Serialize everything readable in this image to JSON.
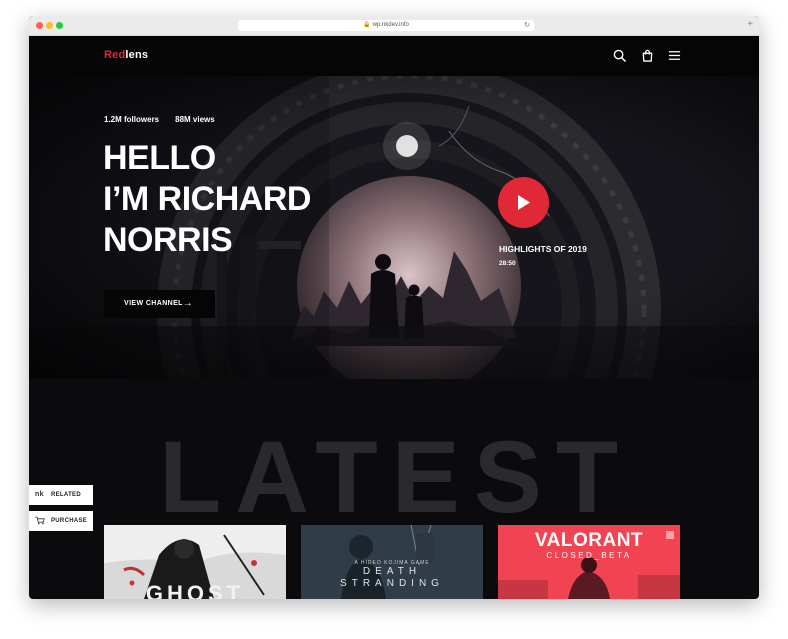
{
  "browser": {
    "url": "wp.nkdev.info"
  },
  "nav": {
    "logo_accent": "Red",
    "logo_rest": "lens",
    "icons": [
      "search-icon",
      "cart-icon",
      "menu-icon"
    ]
  },
  "hero": {
    "followers": "1.2M followers",
    "views": "88M views",
    "headline": [
      "HELLO",
      "I’M RICHARD",
      "NORRIS"
    ],
    "cta_label": "VIEW CHANNEL",
    "cta_icon": "→",
    "highlight_title": "HIGHLIGHTS OF 2019",
    "highlight_duration": "28:50"
  },
  "latest": {
    "watermark": "LATEST"
  },
  "side_buttons": [
    {
      "label": "RELATED",
      "icon": "nk-logo-icon"
    },
    {
      "label": "PURCHASE",
      "icon": "cart-icon"
    }
  ],
  "cards": [
    {
      "title": "GHOST"
    },
    {
      "subtitle": "A HIDEO KOJIMA GAME",
      "title": "DEATH",
      "title2": "STRANDING"
    },
    {
      "title": "VALORANT",
      "subtitle": "CLOSED_BETA"
    }
  ],
  "colors": {
    "accent": "#e02836",
    "background": "#0b0b0d",
    "valorant": "#ff4655"
  }
}
